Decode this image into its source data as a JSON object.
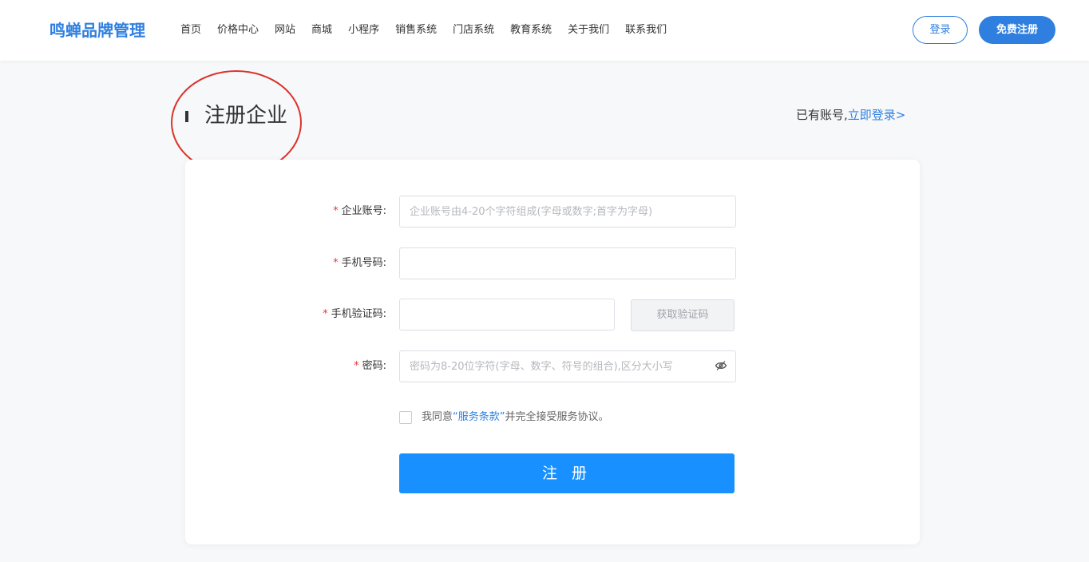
{
  "header": {
    "logo": "鸣蝉品牌管理",
    "nav": [
      "首页",
      "价格中心",
      "网站",
      "商城",
      "小程序",
      "销售系统",
      "门店系统",
      "教育系统",
      "关于我们",
      "联系我们"
    ],
    "login_label": "登录",
    "signup_label": "免费注册"
  },
  "page": {
    "title": "注册企业",
    "has_account": "已有账号,",
    "login_now": "立即登录>"
  },
  "form": {
    "account": {
      "label": "企业账号:",
      "placeholder": "企业账号由4-20个字符组成(字母或数字;首字为字母)",
      "value": ""
    },
    "phone": {
      "label": "手机号码:",
      "placeholder": "",
      "value": ""
    },
    "sms_code": {
      "label": "手机验证码:",
      "placeholder": "",
      "value": "",
      "button_label": "获取验证码"
    },
    "password": {
      "label": "密码:",
      "placeholder": "密码为8-20位字符(字母、数字、符号的组合),区分大小写",
      "value": ""
    },
    "required_mark": "*",
    "agreement": {
      "prefix": "我同意",
      "terms": "“服务条款”",
      "suffix": "并完全接受服务协议。",
      "checked": false
    },
    "submit_label": "注 册"
  },
  "colors": {
    "brand": "#2f7fe0",
    "submit": "#1890ff",
    "required": "#e4393c",
    "annotation": "#d9332b"
  },
  "icons": {
    "password_toggle": "eye-off-icon"
  }
}
